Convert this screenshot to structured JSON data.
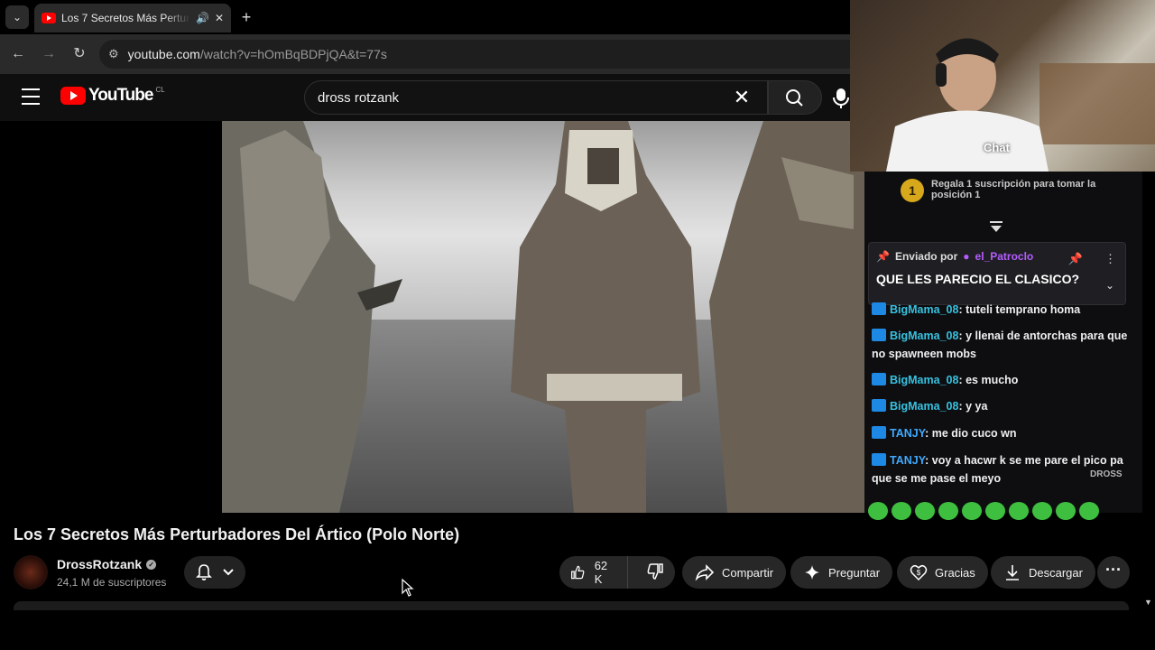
{
  "browser": {
    "tab_title": "Los 7 Secretos Más Perturbadores Del Ártico (Polo Norte)",
    "tab_audio_icon": "speaker-icon",
    "url_host": "youtube.com",
    "url_rest": "/watch?v=hOmBqBDPjQA&t=77s"
  },
  "youtube": {
    "logo_text": "YouTube",
    "country_code": "CL",
    "search_query": "dross rotzank"
  },
  "overlay": {
    "cam_label": "Chat",
    "gift_rank": "1",
    "gift_text": "Regala 1 suscripción para tomar la posición 1",
    "pinned_prefix": "Enviado por",
    "pinned_user": "el_Patroclo",
    "pinned_message": "QUE LES PARECIO EL CLASICO?",
    "chat": [
      {
        "user": "BigMama_08",
        "text": ": tuteli temprano homa"
      },
      {
        "user": "BigMama_08",
        "text": ": y llenai de antorchas para que no spawneen mobs"
      },
      {
        "user": "BigMama_08",
        "text": ": es mucho"
      },
      {
        "user": "BigMama_08",
        "text": ": y ya"
      },
      {
        "user": "TANJY",
        "text": ": me dio cuco wn"
      },
      {
        "user": "TANJY",
        "text": ": voy a hacwr k se me pare el pico pa que se me pase el meyo"
      }
    ],
    "watermark": "DROSS"
  },
  "video": {
    "title": "Los 7 Secretos Más Perturbadores Del Ártico (Polo Norte)",
    "channel": "DrossRotzank",
    "subscribers": "24,1 M de suscriptores",
    "likes": "62 K",
    "share_label": "Compartir",
    "ask_label": "Preguntar",
    "thanks_label": "Gracias",
    "download_label": "Descargar"
  },
  "colors": {
    "youtube_red": "#ff0000",
    "chat_bg": "#0e0e10",
    "pinned_user": "#b45cff"
  }
}
